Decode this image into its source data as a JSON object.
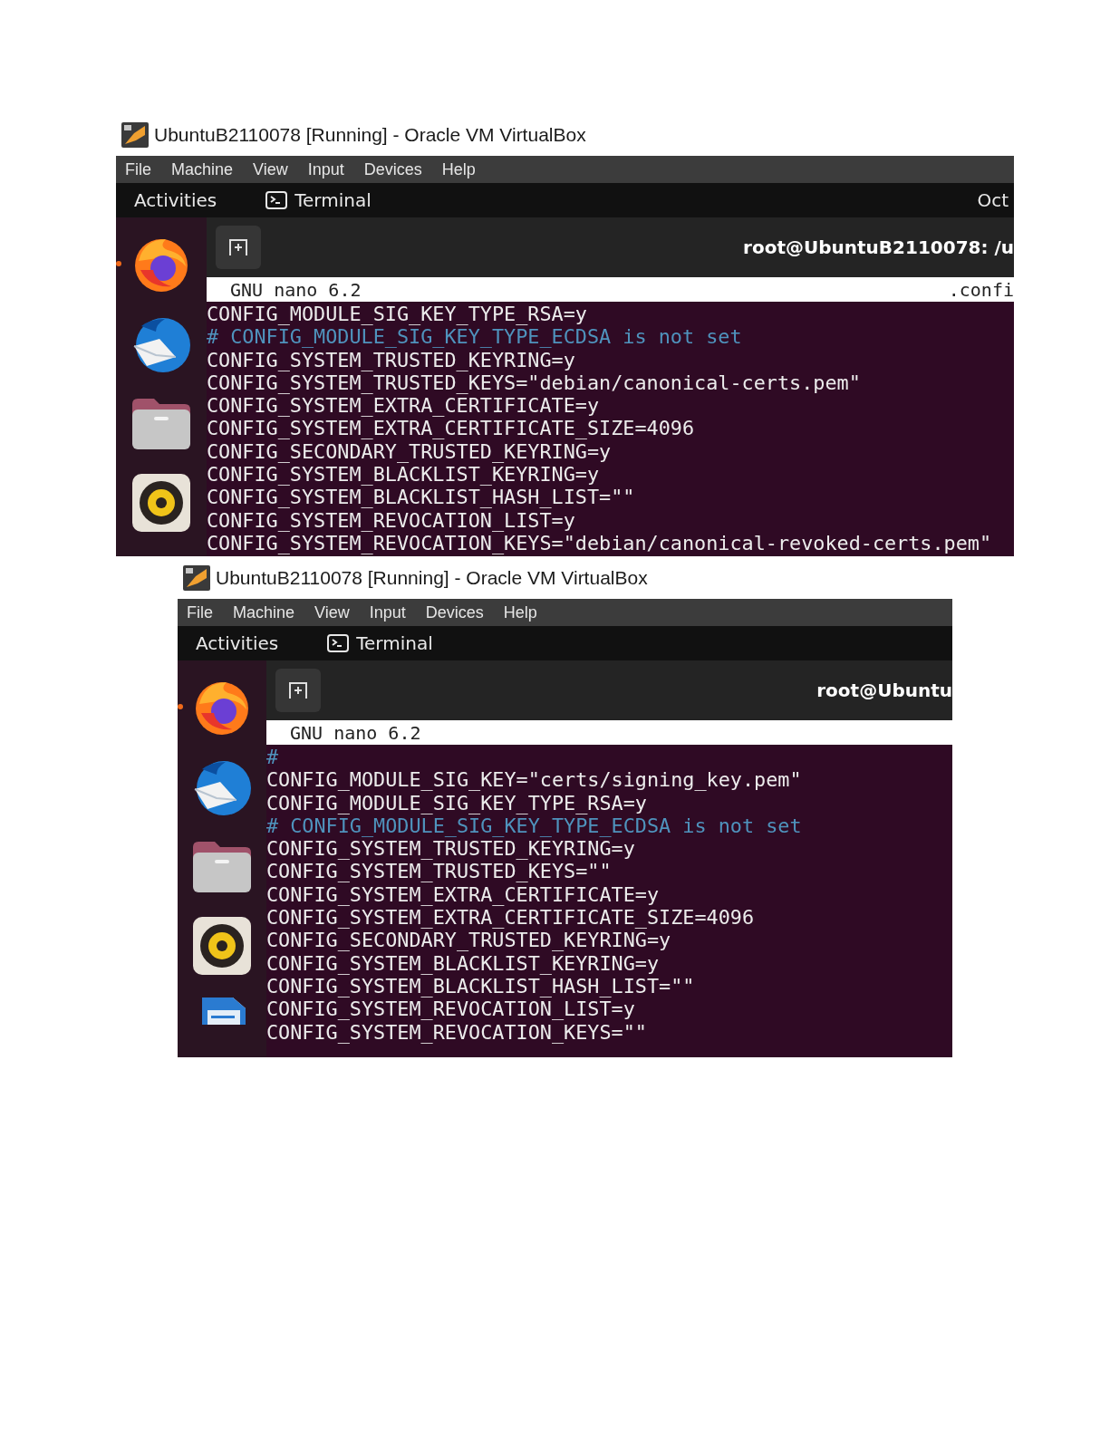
{
  "screenshots": [
    {
      "window_title": "UbuntuB2110078 [Running] - Oracle VM VirtualBox",
      "menu": [
        "File",
        "Machine",
        "View",
        "Input",
        "Devices",
        "Help"
      ],
      "topbar": {
        "activities": "Activities",
        "app": "Terminal",
        "clock": "Oct"
      },
      "dock": [
        {
          "kind": "browser",
          "running": true
        },
        {
          "kind": "mail",
          "running": false
        },
        {
          "kind": "files",
          "running": false
        },
        {
          "kind": "music",
          "running": false
        }
      ],
      "terminal_title": "root@UbuntuB2110078: /u",
      "nano": {
        "version": "GNU nano 6.2",
        "file": ".confi"
      },
      "lines": [
        {
          "kind": "setting",
          "text": "CONFIG_MODULE_SIG_KEY_TYPE_RSA=y"
        },
        {
          "kind": "comment",
          "text": "# CONFIG_MODULE_SIG_KEY_TYPE_ECDSA is not set"
        },
        {
          "kind": "setting",
          "text": "CONFIG_SYSTEM_TRUSTED_KEYRING=y"
        },
        {
          "kind": "setting",
          "text": "CONFIG_SYSTEM_TRUSTED_KEYS=\"debian/canonical-certs.pem\""
        },
        {
          "kind": "setting",
          "text": "CONFIG_SYSTEM_EXTRA_CERTIFICATE=y"
        },
        {
          "kind": "setting",
          "text": "CONFIG_SYSTEM_EXTRA_CERTIFICATE_SIZE=4096"
        },
        {
          "kind": "setting",
          "text": "CONFIG_SECONDARY_TRUSTED_KEYRING=y"
        },
        {
          "kind": "setting",
          "text": "CONFIG_SYSTEM_BLACKLIST_KEYRING=y"
        },
        {
          "kind": "setting",
          "text": "CONFIG_SYSTEM_BLACKLIST_HASH_LIST=\"\""
        },
        {
          "kind": "setting",
          "text": "CONFIG_SYSTEM_REVOCATION_LIST=y"
        },
        {
          "kind": "setting",
          "text": "CONFIG_SYSTEM_REVOCATION_KEYS=\"debian/canonical-revoked-certs.pem\""
        }
      ]
    },
    {
      "window_title": "UbuntuB2110078 [Running] - Oracle VM VirtualBox",
      "menu": [
        "File",
        "Machine",
        "View",
        "Input",
        "Devices",
        "Help"
      ],
      "topbar": {
        "activities": "Activities",
        "app": "Terminal"
      },
      "dock": [
        {
          "kind": "browser",
          "running": true
        },
        {
          "kind": "mail",
          "running": false
        },
        {
          "kind": "files",
          "running": false
        },
        {
          "kind": "music",
          "running": false
        },
        {
          "kind": "writer",
          "running": false
        }
      ],
      "terminal_title": "root@Ubuntu",
      "nano": {
        "version": "GNU nano 6.2"
      },
      "lines": [
        {
          "kind": "comment",
          "text": "#"
        },
        {
          "kind": "setting",
          "text": "CONFIG_MODULE_SIG_KEY=\"certs/signing_key.pem\""
        },
        {
          "kind": "setting",
          "text": "CONFIG_MODULE_SIG_KEY_TYPE_RSA=y"
        },
        {
          "kind": "comment",
          "text": "# CONFIG_MODULE_SIG_KEY_TYPE_ECDSA is not set"
        },
        {
          "kind": "setting",
          "text": "CONFIG_SYSTEM_TRUSTED_KEYRING=y"
        },
        {
          "kind": "setting",
          "text": "CONFIG_SYSTEM_TRUSTED_KEYS=\"\""
        },
        {
          "kind": "setting",
          "text": "CONFIG_SYSTEM_EXTRA_CERTIFICATE=y"
        },
        {
          "kind": "setting",
          "text": "CONFIG_SYSTEM_EXTRA_CERTIFICATE_SIZE=4096"
        },
        {
          "kind": "setting",
          "text": "CONFIG_SECONDARY_TRUSTED_KEYRING=y"
        },
        {
          "kind": "setting",
          "text": "CONFIG_SYSTEM_BLACKLIST_KEYRING=y"
        },
        {
          "kind": "setting",
          "text": "CONFIG_SYSTEM_BLACKLIST_HASH_LIST=\"\""
        },
        {
          "kind": "setting",
          "text": "CONFIG_SYSTEM_REVOCATION_LIST=y"
        },
        {
          "kind": "setting",
          "text": "CONFIG_SYSTEM_REVOCATION_KEYS=\"\""
        }
      ]
    }
  ]
}
